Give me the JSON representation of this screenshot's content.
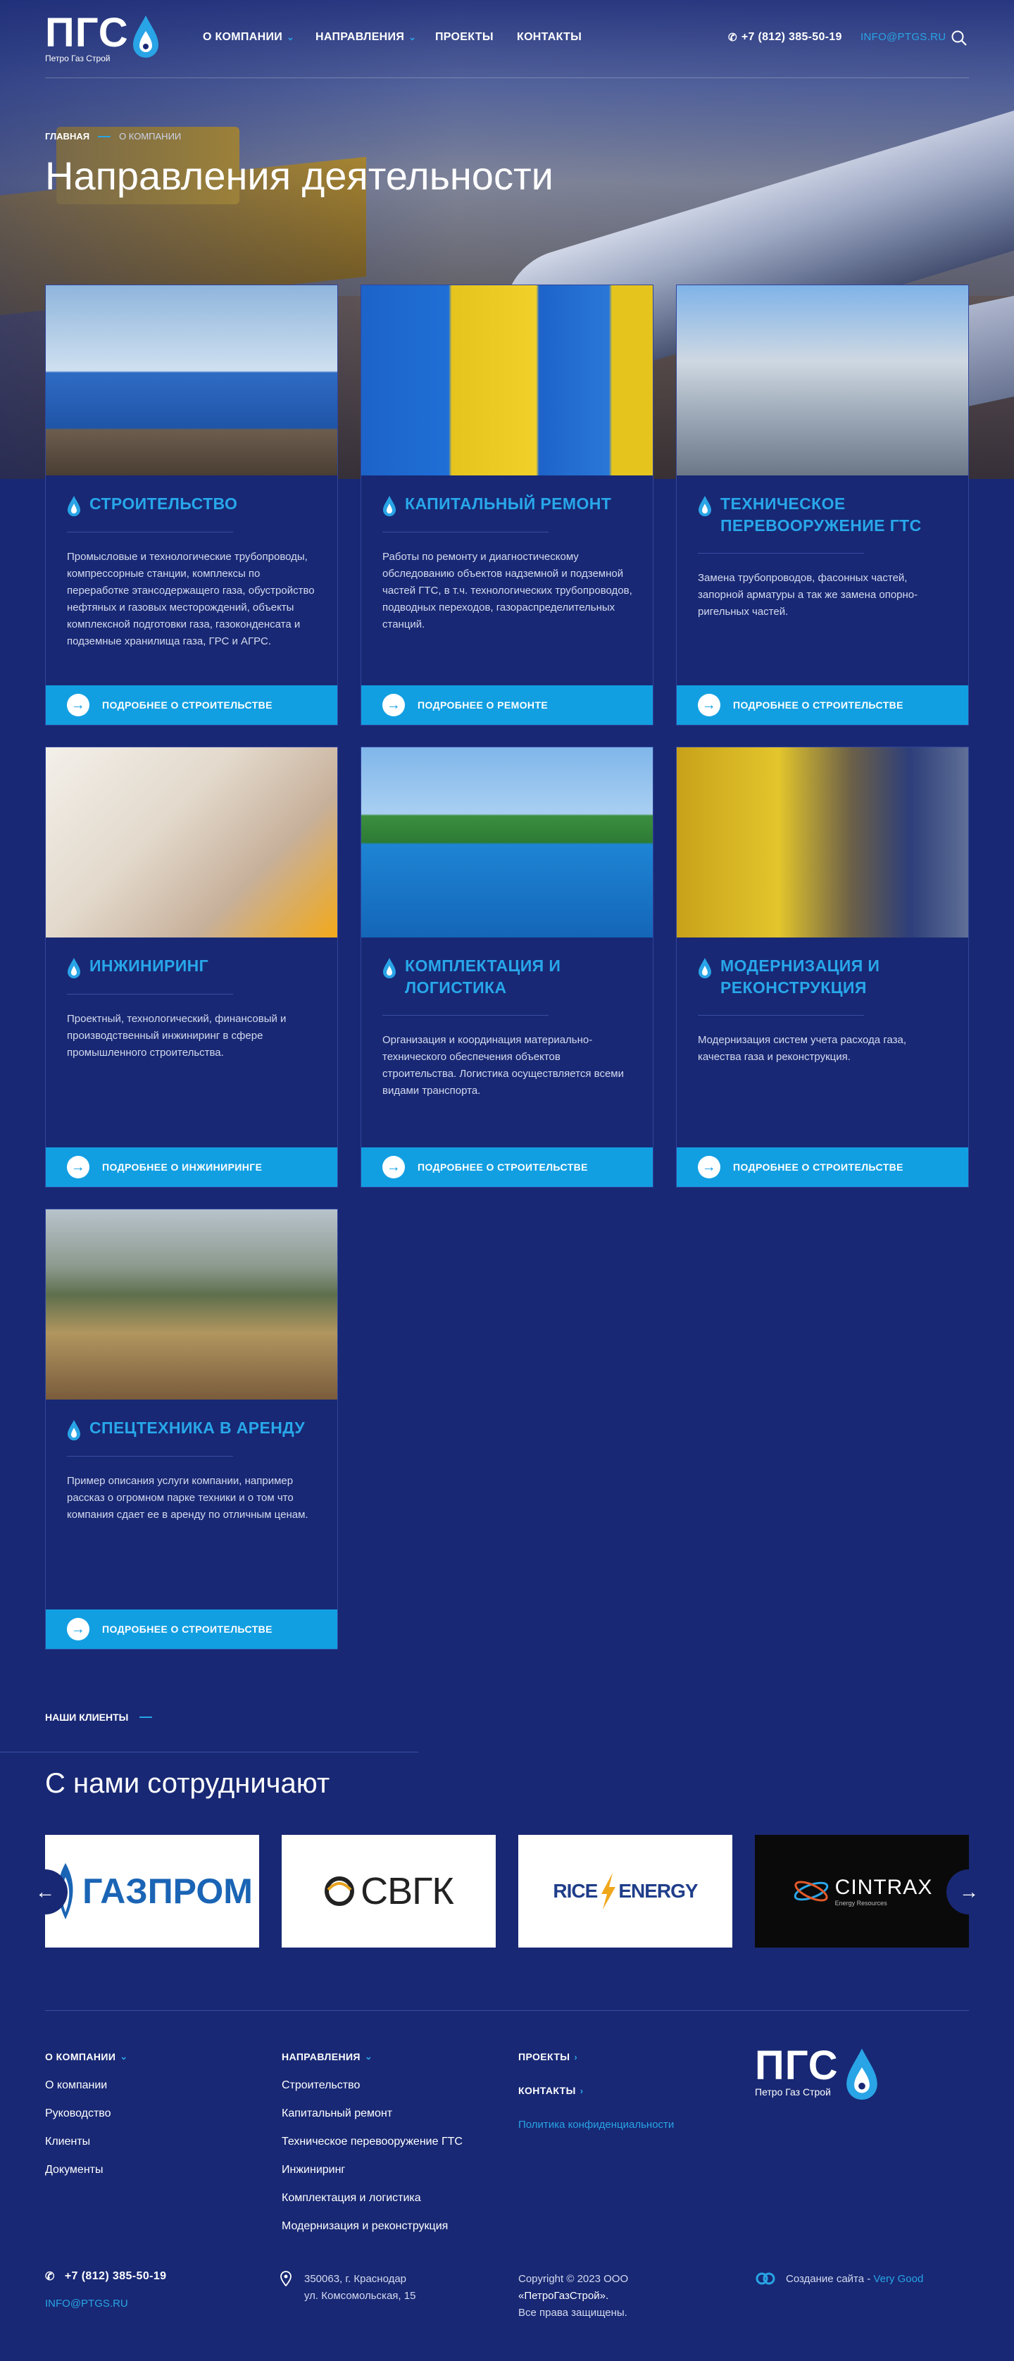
{
  "header": {
    "logo_text": "ПГС",
    "logo_sub": "Петро Газ Строй",
    "nav": [
      {
        "label": "О КОМПАНИИ",
        "has_dropdown": true
      },
      {
        "label": "НАПРАВЛЕНИЯ",
        "has_dropdown": true
      },
      {
        "label": "ПРОЕКТЫ",
        "has_dropdown": false
      },
      {
        "label": "КОНТАКТЫ",
        "has_dropdown": false
      }
    ],
    "phone": "+7 (812) 385-50-19",
    "email": "INFO@PTGS.RU"
  },
  "breadcrumb": {
    "home": "ГЛАВНАЯ",
    "current": "О КОМПАНИИ"
  },
  "page_title": "Направления деятельности",
  "cards": [
    {
      "title": "СТРОИТЕЛЬСТВО",
      "text": "Промысловые и технологические трубопроводы, компрессорные станции, комплексы по переработке этансодержащего газа, обустройство нефтяных и газовых месторождений, объекты комплексной подготовки газа, газоконденсата и подземные хранилища газа, ГРС и АГРС.",
      "button": "ПОДРОБНЕЕ О СТРОИТЕЛЬСТВЕ",
      "image": "construction-site-photo"
    },
    {
      "title": "КАПИТАЛЬНЫЙ РЕМОНТ",
      "text": "Работы по ремонту и диагностическому обследованию объектов надземной и подземной частей ГТС, в т.ч. технологических трубопроводов, подводных переходов, газораспределительных станций.",
      "button": "ПОДРОБНЕЕ О РЕМОНТЕ",
      "image": "yellow-blue-valves-photo"
    },
    {
      "title": "ТЕХНИЧЕСКОЕ ПЕРЕВООРУЖЕНИЕ ГТС",
      "text": "Замена трубопроводов, фасонных частей, запорной арматуры а так же замена опорно-ригельных частей.",
      "button": "ПОДРОБНЕЕ О СТРОИТЕЛЬСТВЕ",
      "image": "workers-pipes-photo"
    },
    {
      "title": "ИНЖИНИРИНГ",
      "text": "Проектный, технологический, финансовый и производственный инжиниринг в сфере промышленного строительства.",
      "button": "ПОДРОБНЕЕ О ИНЖИНИРИНГЕ",
      "image": "engineering-drawings-photo"
    },
    {
      "title": "КОМПЛЕКТАЦИЯ И ЛОГИСТИКА",
      "text": "Организация и координация материально-технического обеспечения объектов строительства. Логистика осуществляется всеми видами транспорта.",
      "button": "ПОДРОБНЕЕ О СТРОИТЕЛЬСТВЕ",
      "image": "blue-tank-truck-photo"
    },
    {
      "title": "МОДЕРНИЗАЦИЯ И РЕКОНСТРУКЦИЯ",
      "text": "Модернизация систем учета расхода газа, качества газа и реконструкция.",
      "button": "ПОДРОБНЕЕ О СТРОИТЕЛЬСТВЕ",
      "image": "engineer-gauges-photo"
    },
    {
      "title": "СПЕЦТЕХНИКА В АРЕНДУ",
      "text": "Пример описания услуги компании, например рассказ о огромном парке техники и о том что компания сдает ее в аренду по отличным ценам.",
      "button": "ПОДРОБНЕЕ О СТРОИТЕЛЬСТВЕ",
      "image": "excavator-photo"
    }
  ],
  "clients": {
    "label": "НАШИ КЛИЕНТЫ",
    "title": "С нами сотрудничают",
    "logos": [
      "ГАЗПРОМ",
      "СВГК",
      "RICE",
      "ENERGY",
      "CINTRAX",
      "Energy Resources"
    ]
  },
  "footer": {
    "col1": {
      "head": "О КОМПАНИИ",
      "links": [
        "О компании",
        "Руководство",
        "Клиенты",
        "Документы"
      ]
    },
    "col2": {
      "head": "НАПРАВЛЕНИЯ",
      "links": [
        "Строительство",
        "Капитальный ремонт",
        "Техническое перевооружение ГТС",
        "Инжиниринг",
        "Комплектация и логистика",
        "Модернизация и реконструкция"
      ]
    },
    "col3": {
      "projects": "ПРОЕКТЫ",
      "contacts": "КОНТАКТЫ",
      "privacy": "Политика конфиденциальности"
    },
    "phone": "+7 (812) 385-50-19",
    "email": "INFO@PTGS.RU",
    "address1": "350063, г. Краснодар",
    "address2": "ул. Комсомольская, 15",
    "copyright1": "Copyright © 2023 ООО",
    "copyright2": "«ПетроГазСтрой».",
    "copyright3": "Все права защищены.",
    "made_by_label": "Создание сайта - ",
    "made_by_link": "Very Good"
  },
  "colors": {
    "bg": "#182874",
    "accent": "#129fe2",
    "title_blue": "#28a7ea"
  }
}
